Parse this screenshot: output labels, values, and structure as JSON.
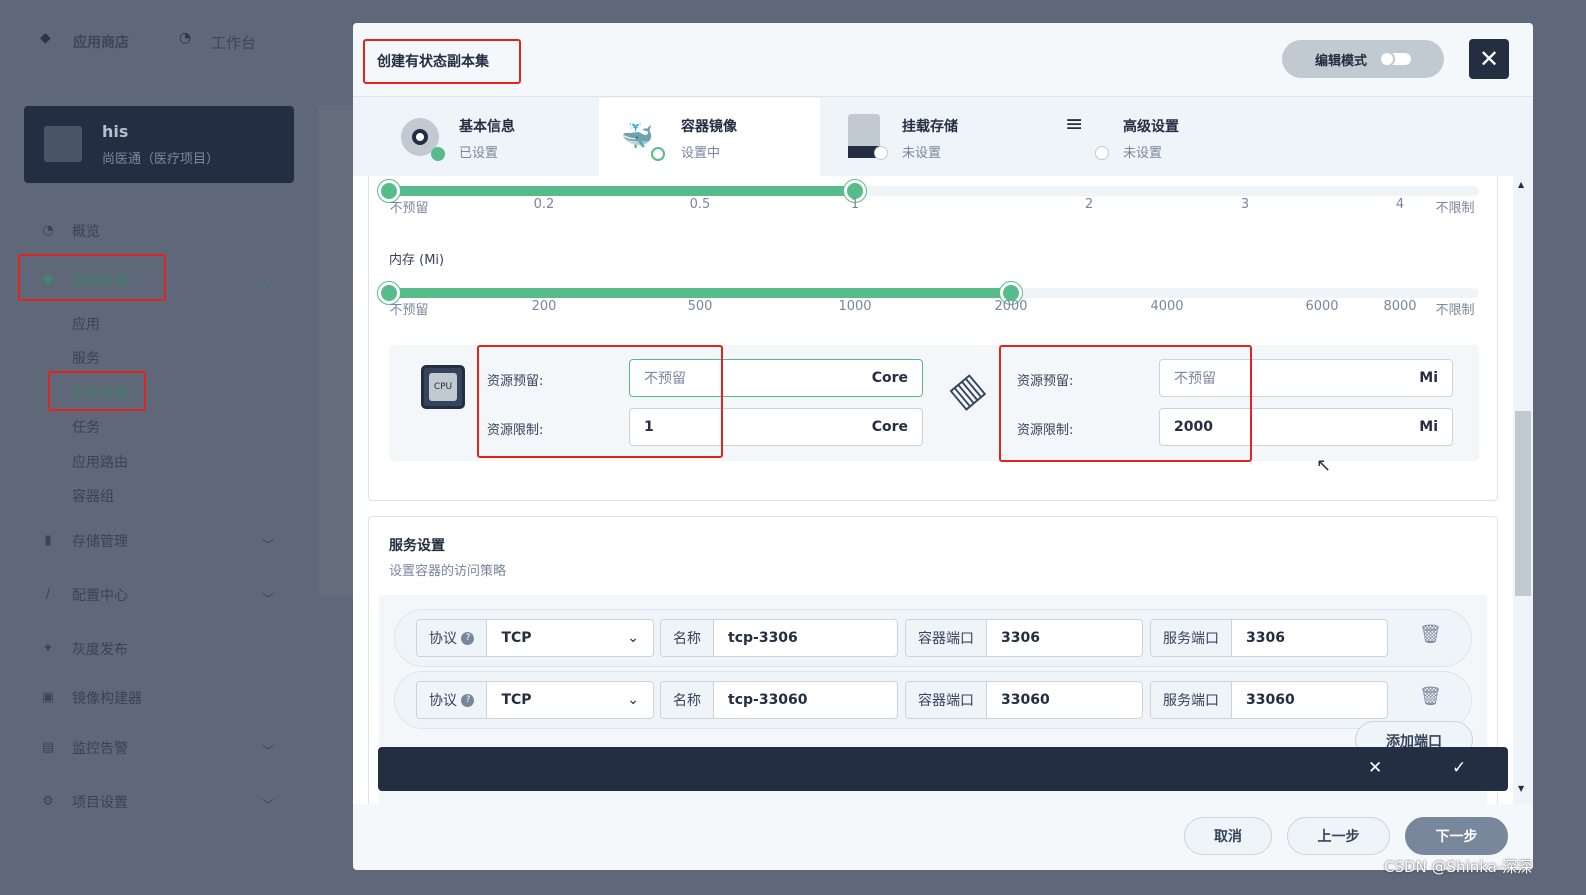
{
  "topnav": {
    "app_store": "应用商店",
    "workbench": "工作台"
  },
  "project": {
    "name": "his",
    "desc": "尚医通（医疗项目）"
  },
  "sidebar": {
    "overview": "概览",
    "workloads": "应用负载",
    "sub": [
      "应用",
      "服务",
      "工作负载",
      "任务",
      "应用路由",
      "容器组"
    ],
    "storage": "存储管理",
    "config": "配置中心",
    "grayscale": "灰度发布",
    "image_builder": "镜像构建器",
    "monitoring": "监控告警",
    "project_settings": "项目设置"
  },
  "modal": {
    "title": "创建有状态副本集",
    "edit_mode": "编辑模式",
    "steps": [
      {
        "title": "基本信息",
        "status": "已设置"
      },
      {
        "title": "容器镜像",
        "status": "设置中"
      },
      {
        "title": "挂载存储",
        "status": "未设置"
      },
      {
        "title": "高级设置",
        "status": "未设置"
      }
    ],
    "cpu_slider": {
      "ticks": [
        "不预留",
        "0.2",
        "0.5",
        "1",
        "2",
        "3",
        "4",
        "不限制"
      ],
      "range": [
        "不预留",
        "1"
      ]
    },
    "memory_label": "内存 (Mi)",
    "memory_slider": {
      "ticks": [
        "不预留",
        "200",
        "500",
        "1000",
        "2000",
        "4000",
        "6000",
        "8000",
        "不限制"
      ],
      "range": [
        "不预留",
        "2000"
      ]
    },
    "cpu": {
      "icon_text": "CPU",
      "reserve_label": "资源预留:",
      "reserve_placeholder": "不预留",
      "reserve_unit": "Core",
      "limit_label": "资源限制:",
      "limit_value": "1",
      "limit_unit": "Core"
    },
    "memory": {
      "reserve_label": "资源预留:",
      "reserve_placeholder": "不预留",
      "reserve_unit": "Mi",
      "limit_label": "资源限制:",
      "limit_value": "2000",
      "limit_unit": "Mi"
    },
    "service": {
      "title": "服务设置",
      "desc": "设置容器的访问策略",
      "ports": [
        {
          "protocol_label": "协议",
          "protocol": "TCP",
          "name_label": "名称",
          "name": "tcp-3306",
          "container_port_label": "容器端口",
          "container_port": "3306",
          "service_port_label": "服务端口",
          "service_port": "3306"
        },
        {
          "protocol_label": "协议",
          "protocol": "TCP",
          "name_label": "名称",
          "name": "tcp-33060",
          "container_port_label": "容器端口",
          "container_port": "33060",
          "service_port_label": "服务端口",
          "service_port": "33060"
        }
      ],
      "add_port": "添加端口"
    },
    "footer": {
      "cancel": "取消",
      "prev": "上一步",
      "next": "下一步"
    }
  },
  "watermark": "CSDN @Shinka-深深",
  "colors": {
    "accent": "#55bc8a",
    "dark": "#242e42",
    "highlight": "#e0251f"
  }
}
